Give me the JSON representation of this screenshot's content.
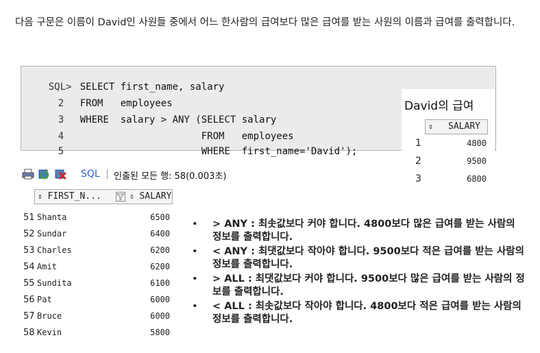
{
  "intro_text": "다음 구문은 이름이 David인 사원들 중에서 어느 한사람의 급여보다 많은 급여를 받는 사원의 이름과 급여를 출력합니다.",
  "sql_editor": {
    "lines": [
      {
        "num": "SQL>",
        "code": "SELECT first_name, salary"
      },
      {
        "num": "2",
        "code": "FROM   employees"
      },
      {
        "num": "3",
        "code": "WHERE  salary > ANY (SELECT salary"
      },
      {
        "num": "4",
        "code": "                     FROM   employees"
      },
      {
        "num": "5",
        "code": "                     WHERE  first_name='David');"
      }
    ]
  },
  "david_salary": {
    "title": "David의 급여",
    "column": "SALARY",
    "rows": [
      {
        "index": "1",
        "value": "4800"
      },
      {
        "index": "2",
        "value": "9500"
      },
      {
        "index": "3",
        "value": "6800"
      }
    ]
  },
  "result_toolbar": {
    "sql_label": "SQL",
    "status": "인출된 모든 행: 58(0.003초)"
  },
  "result_grid": {
    "columns": [
      "FIRST_N...",
      "SALARY"
    ],
    "rows": [
      {
        "num": "51",
        "name": "Shanta",
        "salary": "6500"
      },
      {
        "num": "52",
        "name": "Sundar",
        "salary": "6400"
      },
      {
        "num": "53",
        "name": "Charles",
        "salary": "6200"
      },
      {
        "num": "54",
        "name": "Amit",
        "salary": "6200"
      },
      {
        "num": "55",
        "name": "Sundita",
        "salary": "6100"
      },
      {
        "num": "56",
        "name": "Pat",
        "salary": "6000"
      },
      {
        "num": "57",
        "name": "Bruce",
        "salary": "6000"
      },
      {
        "num": "58",
        "name": "Kevin",
        "salary": "5800"
      }
    ]
  },
  "notes": [
    "> ANY : 최솟값보다 커야 합니다. 4800보다 많은 급여를 받는 사람의 정보를 출력합니다.",
    "< ANY : 최댓값보다 작아야 합니다. 9500보다 적은 급여를 받는 사람의 정보를 출력합니다.",
    "> ALL : 최댓값보다 커야 합니다. 9500보다 많은 급여를 받는 사람의 정보를 출력합니다.",
    "< ALL : 최솟값보다 작아야 합니다. 4800보다 적은 급여를 받는 사람의 정보를 출력합니다."
  ],
  "colors": {
    "sql_link": "#2e62c9",
    "editor_bg": "#ebebeb"
  }
}
